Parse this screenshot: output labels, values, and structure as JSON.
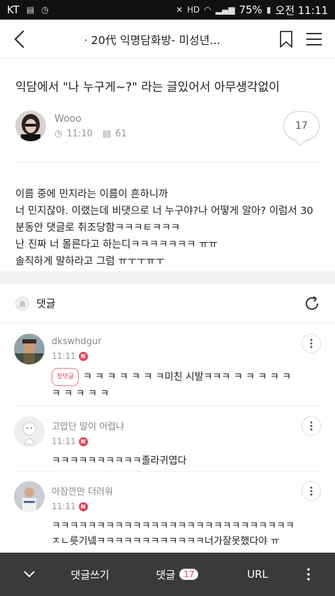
{
  "statusbar": {
    "carrier": "KT",
    "battery": "75%",
    "time": "오전 11:11"
  },
  "topbar": {
    "title": "· 20代 익명담화방- 미성년..."
  },
  "post": {
    "title": "익담에서 \"나 누구게~?\" 라는 글있어서 아무생각없이",
    "author": "Wooo",
    "time": "11:10",
    "views": "61",
    "comment_count": "17",
    "body_lines": [
      "이름 중에 민지라는 이름이 흔하니까",
      "너 민지잖아. 이랬는데 비댓으로 너 누구야?나 어떻게 알아? 이럼서 30",
      "분동안 댓글로 취조당함ㅋㅋㅋㅌㅋㅋㅋ",
      "난 진짜 너 몰른다고 하는디ㅋㅋㅋㅋㅋㅋㅋ ㅠㅠ",
      "솔직하게 말하라고 그럼 ㅠㅜㅜㅠㅜ"
    ]
  },
  "comments_header": {
    "label": "댓글"
  },
  "comments": [
    {
      "name": "dkswhdgur",
      "time": "11:11",
      "badge": "첫댓글",
      "text": "ㅋ ㅋ ㅋ ㅋ ㅋ ㅋ ㅋ미친 시발ㅋㅋㅋ ㅋ ㅋ ㅋ ㅋ ㅋ ㅋ ㅋ ㅋ ㅋ ㅋ",
      "new": "N"
    },
    {
      "name": "고맙단 말이 어렵냐",
      "time": "11:11",
      "text": "ㅋㅋㅋㅋㅋㅋㅋㅋㅋㅋ졸라귀엽다",
      "new": "N"
    },
    {
      "name": "아잠깐만 더러워",
      "time": "11:11",
      "text": "ㅋㅋㅋㅋㅋㅋㅋㅋㅋㅋㅋㅋㅋㅋㅋㅋㅋㅋㅋㅋㅋㅋㅋㅋㅋㅋㅋㅈㄴ릇기넼ㅋㅋㅋㅋㅋㅋㅋㅋㅋㅋㅋㅋ너가잘못했다야 ㅠ",
      "new": "N"
    }
  ],
  "bottombar": {
    "write_label": "댓글쓰기",
    "comments_label": "댓글",
    "comments_count": "17",
    "url_label": "URL"
  },
  "colors": {
    "accent": "#e0455b",
    "bottombar": "#3a3a3a"
  }
}
